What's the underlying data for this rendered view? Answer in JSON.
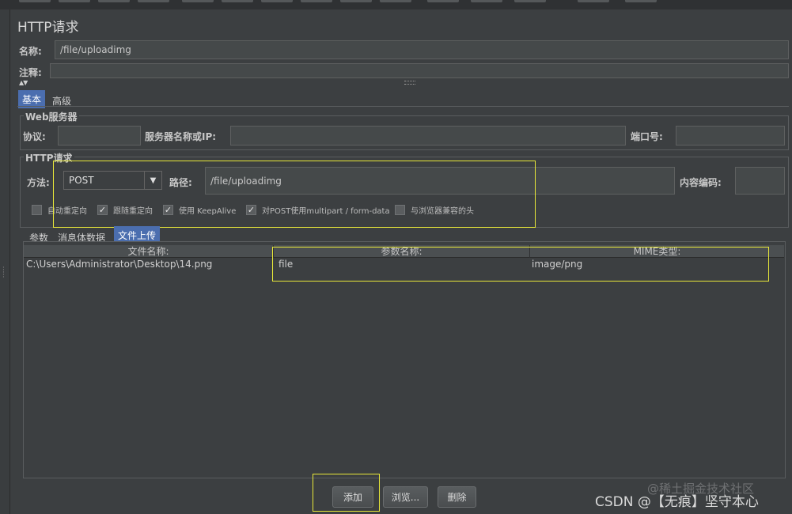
{
  "panel_title": "HTTP请求",
  "name": {
    "label": "名称:",
    "value": "/file/uploadimg"
  },
  "comment": {
    "label": "注释:",
    "value": ""
  },
  "tabs": [
    {
      "label": "基本"
    },
    {
      "label": "高级"
    }
  ],
  "web_server": {
    "legend": "Web服务器",
    "protocol_label": "协议:",
    "protocol_value": "",
    "server_label": "服务器名称或IP:",
    "server_value": "",
    "port_label": "端口号:",
    "port_value": ""
  },
  "http_request": {
    "legend": "HTTP请求",
    "method_label": "方法:",
    "method_value": "POST",
    "path_label": "路径:",
    "path_value": "/file/uploadimg",
    "encoding_label": "内容编码:",
    "encoding_value": "",
    "checkboxes": [
      {
        "label": "自动重定向",
        "checked": false
      },
      {
        "label": "跟随重定向",
        "checked": true
      },
      {
        "label": "使用 KeepAlive",
        "checked": true
      },
      {
        "label": "对POST使用multipart / form-data",
        "checked": true
      },
      {
        "label": "与浏览器兼容的头",
        "checked": false
      }
    ]
  },
  "subtabs": [
    {
      "label": "参数"
    },
    {
      "label": "消息体数据"
    },
    {
      "label": "文件上传"
    }
  ],
  "files_table": {
    "columns": [
      "文件名称:",
      "参数名称:",
      "MIME类型:"
    ],
    "rows": [
      {
        "file": "C:\\Users\\Administrator\\Desktop\\14.png",
        "param": "file",
        "mime": "image/png"
      }
    ]
  },
  "buttons": {
    "add": "添加",
    "browse": "浏览...",
    "delete": "删除"
  },
  "watermarks": {
    "juejin": "@稀土掘金技术社区",
    "csdn": "CSDN @【无痕】坚守本心"
  },
  "colors": {
    "background": "#3c3f41",
    "active_tab": "#4b6eaf",
    "highlight": "#e8e839"
  }
}
